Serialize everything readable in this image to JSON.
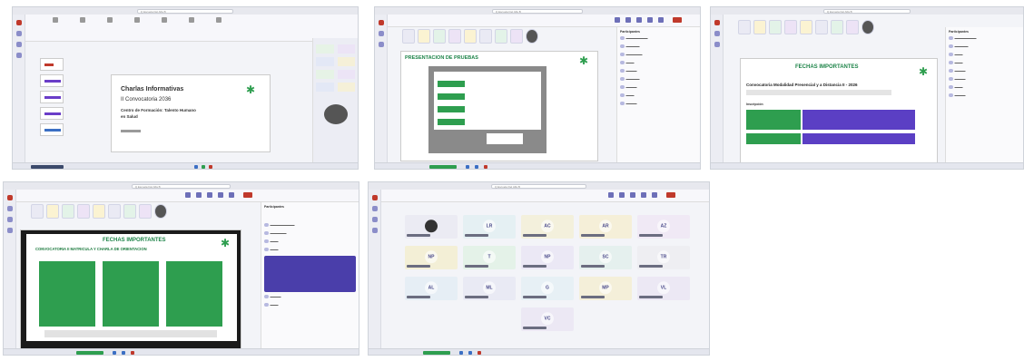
{
  "window": {
    "search_placeholder": "Q  Escuela Del Alfa B"
  },
  "screens": {
    "s1": {
      "slide_title": "Charlas Informativas",
      "slide_line2": "II Convocatoria 2036",
      "slide_line3": "Centro de Formación: Talento Humano",
      "slide_line4": "en Salud"
    },
    "s2": {
      "slide_title": "PRESENTACION DE PRUEBAS",
      "panel_title": "Participantes"
    },
    "s3": {
      "slide_title": "FECHAS IMPORTANTES",
      "subtitle": "Convocatoria Modalidad Presencial y a Distancia II - 2026",
      "section": "Inscripción",
      "panel_title": "Participantes"
    },
    "s4": {
      "slide_title": "FECHAS IMPORTANTES",
      "subtitle": "CONVOCATORIA II MATRICULA Y CHARLA DE ORIENTACION",
      "panel_title": "Participantes"
    },
    "s5": {
      "tiles": [
        "",
        "LR",
        "AC",
        "AR",
        "AZ",
        "NP",
        "T",
        "NP",
        "SC",
        "TR",
        "AL",
        "ML",
        "G",
        "MP",
        "VL",
        "VC"
      ]
    }
  },
  "colors": {
    "green": "#2e9e4f",
    "purple": "#5b3fc4",
    "accent": "#6d6fb8"
  }
}
